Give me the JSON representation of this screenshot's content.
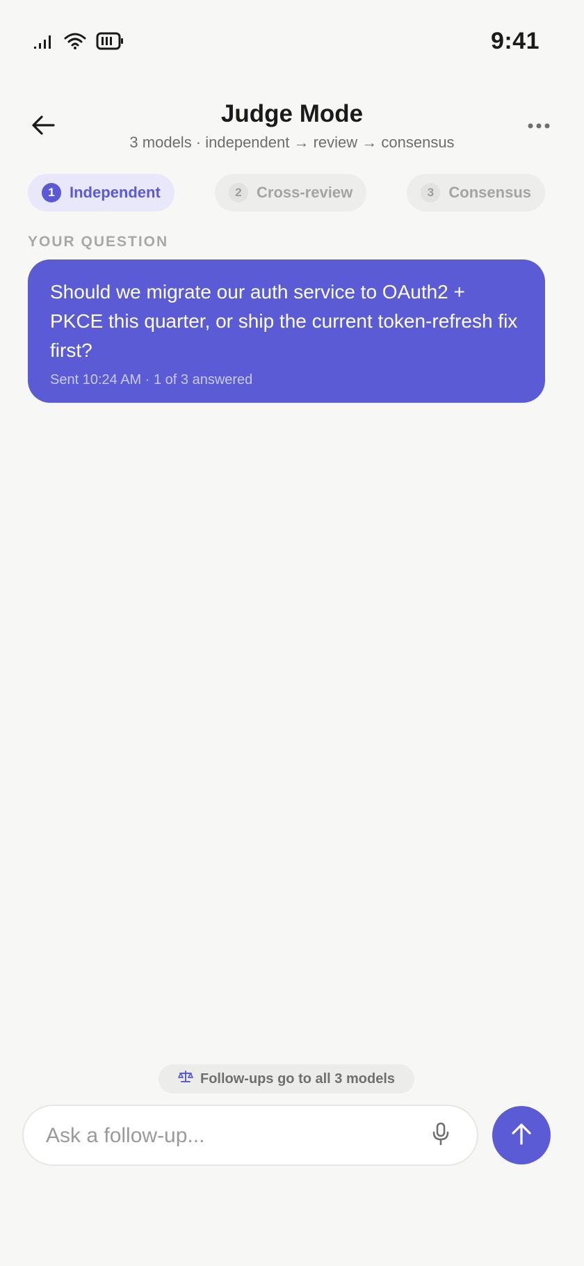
{
  "status_bar": {
    "time": "9:41",
    "icons": [
      "signal-icon",
      "wifi-icon",
      "battery-icon"
    ]
  },
  "header": {
    "title": "Judge Mode",
    "subtitle": "3 models · independent → review → consensus",
    "back_icon": "arrow-left-icon",
    "more_icon": "more-horizontal-icon"
  },
  "steps": [
    {
      "number": "1",
      "label": "Independent",
      "state": "active"
    },
    {
      "number": "2",
      "label": "Cross-review",
      "state": "inactive"
    },
    {
      "number": "3",
      "label": "Consensus",
      "state": "inactive"
    }
  ],
  "question": {
    "section_label": "YOUR QUESTION",
    "text": "Should we migrate our auth service to OAuth2 + PKCE this quarter, or ship the current token-refresh fix first?",
    "meta": "Sent 10:24 AM · 1 of 3 answered"
  },
  "followup_note": {
    "icon": "scale-icon",
    "text": "Follow-ups go to all 3 models"
  },
  "composer": {
    "placeholder": "Ask a follow-up...",
    "value": "",
    "mic_icon": "mic-icon",
    "send_icon": "arrow-up-icon"
  },
  "colors": {
    "accent": "#5b5bd6",
    "background": "#f7f7f5",
    "accent_soft": "#e9e8fb"
  }
}
